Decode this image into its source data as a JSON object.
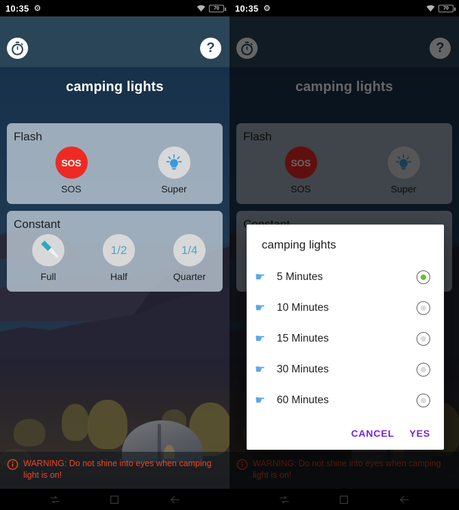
{
  "statusbar": {
    "time": "10:35",
    "gear_icon": "gear-icon",
    "wifi_icon": "wifi-icon",
    "battery_level": "70"
  },
  "app": {
    "title": "camping lights",
    "timer_icon": "stopwatch-icon",
    "help_label": "?",
    "cards": [
      {
        "title": "Flash",
        "options": [
          {
            "label": "SOS",
            "icon": "sos-icon",
            "icon_text": "SOS"
          },
          {
            "label": "Super",
            "icon": "lightbulb-icon",
            "icon_text": ""
          }
        ]
      },
      {
        "title": "Constant",
        "options": [
          {
            "label": "Full",
            "icon": "flashlight-icon",
            "icon_text": ""
          },
          {
            "label": "Half",
            "icon": "fraction-icon",
            "icon_text": "1/2"
          },
          {
            "label": "Quarter",
            "icon": "fraction-icon",
            "icon_text": "1/4"
          }
        ]
      }
    ],
    "warning": {
      "icon": "info-circle-icon",
      "text": "WARNING: Do not shine into eyes when camping light is on!"
    }
  },
  "dialog": {
    "title": "camping lights",
    "hand_icon": "pointing-hand-icon",
    "items": [
      {
        "label": "5 Minutes",
        "selected": true
      },
      {
        "label": "10 Minutes",
        "selected": false
      },
      {
        "label": "15 Minutes",
        "selected": false
      },
      {
        "label": "30 Minutes",
        "selected": false
      },
      {
        "label": "60 Minutes",
        "selected": false
      }
    ],
    "cancel_label": "CANCEL",
    "confirm_label": "YES"
  },
  "navbar": {
    "recents_icon": "recents-icon",
    "home_icon": "home-icon",
    "back_icon": "back-icon"
  },
  "colors": {
    "app_bg": "#2b445c",
    "topbar": "#2b4558",
    "card_bg": "#becad6",
    "sos_red": "#ee2a24",
    "accent_blue": "#4aa3c7",
    "warning_red": "#e8472b",
    "dialog_action": "#7722e0",
    "radio_selected": "#6cc024"
  }
}
